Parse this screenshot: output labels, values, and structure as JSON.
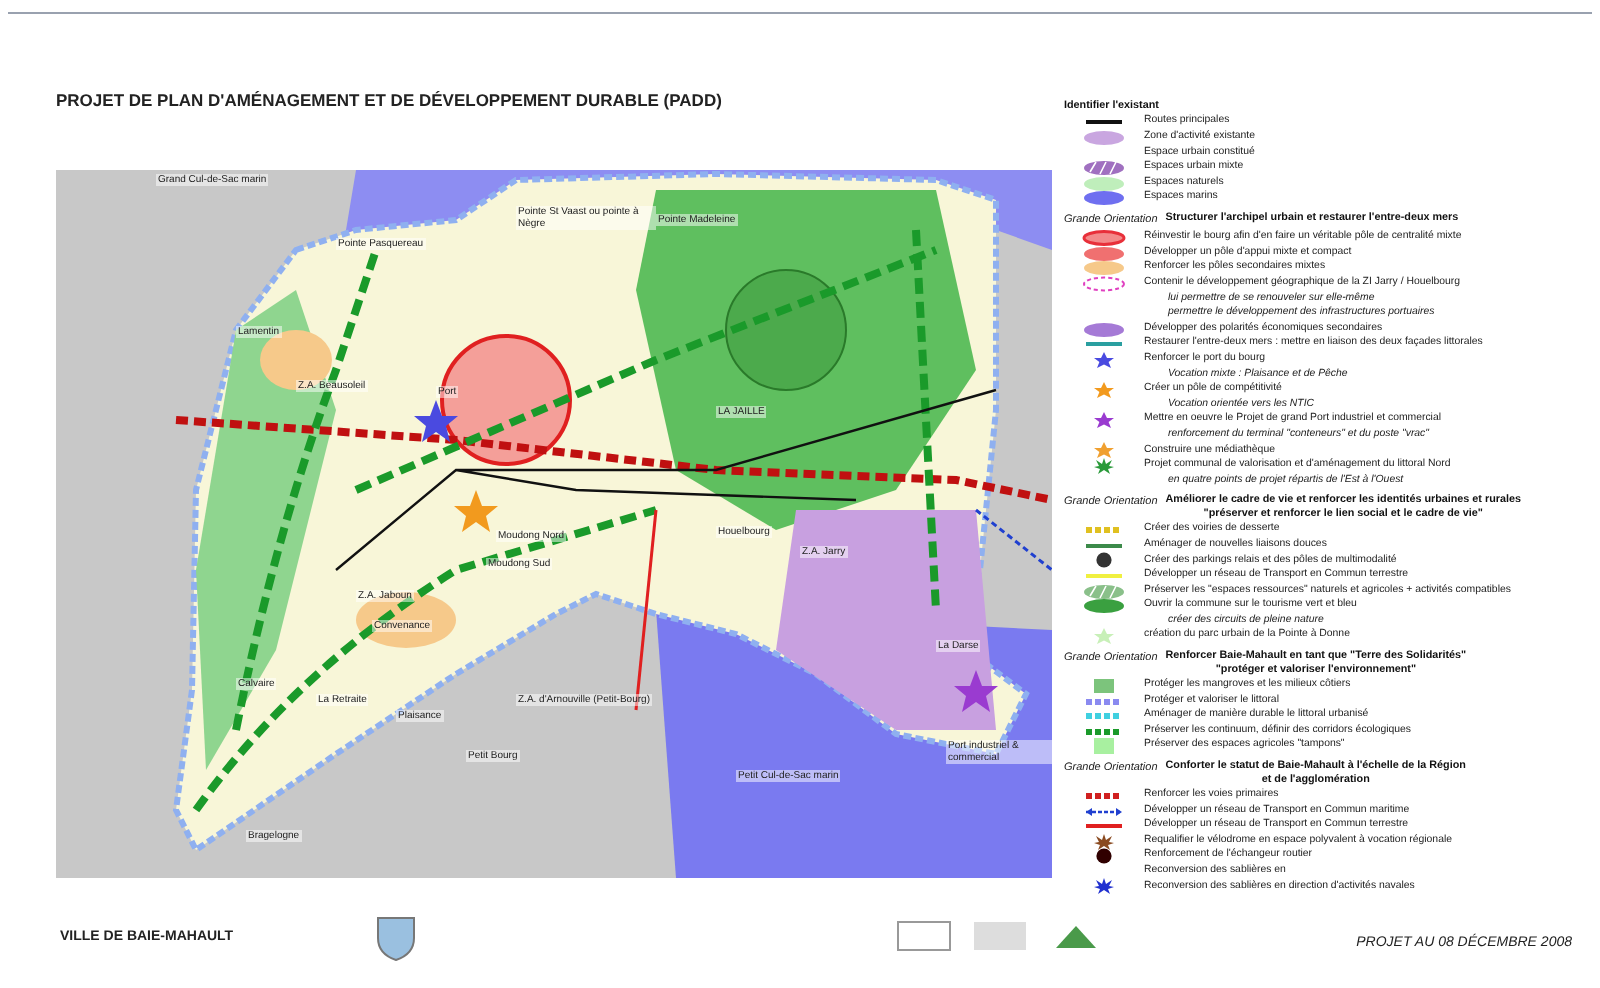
{
  "title": "PROJET DE PLAN D'AMÉNAGEMENT ET DE DÉVELOPPEMENT DURABLE (PADD)",
  "map_labels": [
    "Grand Cul-de-Sac marin",
    "Pointe St Vaast ou pointe à Nègre",
    "Pointe Madeleine",
    "Pointe Pasquereau",
    "Lamentin",
    "Z.A. Beausoleil",
    "LA JAILLE",
    "Moudong Nord",
    "Moudong Sud",
    "Houelbourg",
    "Z.A. Jarry",
    "Z.A. Jaboun",
    "Convenance",
    "Calvaire",
    "La Retraite",
    "Plaisance",
    "Bragelogne",
    "Petit Bourg",
    "Z.A. d'Arnouville (Petit-Bourg)",
    "Petit Cul-de-Sac marin",
    "La Darse",
    "Port",
    "Port industriel & commercial"
  ],
  "legend": [
    {
      "heading": "Identifier l'existant",
      "items": [
        {
          "kind": "line",
          "color": "#111111",
          "text": "Routes principales"
        },
        {
          "kind": "ellipse",
          "color": "#c9a6e0",
          "text": "Zone d'activité existante"
        },
        {
          "kind": "none",
          "text": "Espace urbain constitué"
        },
        {
          "kind": "hatch",
          "color": "#a070c0",
          "text": "Espaces urbain mixte"
        },
        {
          "kind": "ellipse",
          "color": "#bfeebb",
          "text": "Espaces naturels"
        },
        {
          "kind": "ellipse",
          "color": "#6f6ff0",
          "text": "Espaces marins"
        }
      ]
    },
    {
      "label": "Grande Orientation",
      "heading": "Structurer l'archipel urbain et restaurer l'entre-deux mers",
      "items": [
        {
          "kind": "ring",
          "color": "#e8303a",
          "text": "Réinvestir le bourg afin d'en faire un véritable pôle de centralité mixte"
        },
        {
          "kind": "ellipse",
          "color": "#f07070",
          "text": "Développer un pôle d'appui mixte et compact"
        },
        {
          "kind": "ellipse",
          "color": "#f6c98a",
          "text": "Renforcer les  pôles secondaires mixtes"
        },
        {
          "kind": "dashring",
          "color": "#e040c0",
          "text": "Contenir le développement géographique de la ZI Jarry / Houelbourg"
        },
        {
          "kind": "note",
          "text": "lui permettre de se renouveler sur elle-même"
        },
        {
          "kind": "note",
          "text": "permettre le développement des infrastructures portuaires"
        },
        {
          "kind": "ellipse",
          "color": "#a57ad6",
          "text": "Développer des polarités économiques secondaires"
        },
        {
          "kind": "line",
          "color": "#2a9fa0",
          "text": "Restaurer l'entre-deux mers : mettre en liaison des deux façades littorales"
        },
        {
          "kind": "star",
          "color": "#4a4ae0",
          "text": "Renforcer le port du bourg"
        },
        {
          "kind": "note",
          "text": "Vocation mixte : Plaisance et de Pêche"
        },
        {
          "kind": "star",
          "color": "#f29a1e",
          "text": "Créer un pôle de compétitivité"
        },
        {
          "kind": "note",
          "text": "Vocation orientée vers les NTIC"
        },
        {
          "kind": "star",
          "color": "#9a3bd0",
          "text": "Mettre en oeuvre le Projet de grand Port industriel et commercial"
        },
        {
          "kind": "note",
          "text": "renforcement du terminal \"conteneurs\" et du poste \"vrac\""
        },
        {
          "kind": "star",
          "color": "#f0a030",
          "text": "Construire une médiathèque"
        },
        {
          "kind": "burst",
          "color": "#2a9a3a",
          "text": "Projet communal de valorisation et d'aménagement du littoral Nord"
        },
        {
          "kind": "note",
          "text": "en quatre points de projet répartis de l'Est à l'Ouest"
        }
      ]
    },
    {
      "label": "Grande Orientation",
      "heading": "Améliorer le cadre de vie et renforcer les identités urbaines et rurales",
      "subheading": "\"préserver et renforcer le lien social et le cadre de vie\"",
      "items": [
        {
          "kind": "dash",
          "color": "#e0c020",
          "text": "Créer des voiries de desserte"
        },
        {
          "kind": "line",
          "color": "#3c8a4a",
          "text": "Aménager de nouvelles liaisons douces"
        },
        {
          "kind": "circle",
          "color": "#333333",
          "text": "Créer des parkings relais et des pôles de multimodalité"
        },
        {
          "kind": "line",
          "color": "#f0f040",
          "text": "Développer un réseau de Transport en Commun terrestre"
        },
        {
          "kind": "hatch",
          "color": "#8ac08a",
          "text": "Préserver les \"espaces ressources\" naturels et agricoles + activités compatibles"
        },
        {
          "kind": "ellipse",
          "color": "#3aa040",
          "text": "Ouvrir la commune sur le tourisme vert et bleu"
        },
        {
          "kind": "note",
          "text": "créer des circuits de pleine nature"
        },
        {
          "kind": "star",
          "color": "#c8f0b8",
          "text": "création du parc urbain de la Pointe à Donne"
        }
      ]
    },
    {
      "label": "Grande Orientation",
      "heading": "Renforcer Baie-Mahault en tant que \"Terre des Solidarités\"",
      "subheading": "\"protéger et valoriser l'environnement\"",
      "items": [
        {
          "kind": "rect",
          "color": "#7cc47c",
          "text": "Protéger les mangroves et les milieux côtiers"
        },
        {
          "kind": "dash",
          "color": "#8a8af0",
          "text": "Protéger et valoriser le littoral"
        },
        {
          "kind": "dash",
          "color": "#40d0e0",
          "text": "Aménager de manière durable le littoral urbanisé"
        },
        {
          "kind": "dash",
          "color": "#1a9a2a",
          "text": "Préserver les continuum, définir des corridors écologiques"
        },
        {
          "kind": "block",
          "color": "#a8f0a0",
          "text": "Préserver des espaces agricoles \"tampons\""
        }
      ]
    },
    {
      "label": "Grande Orientation",
      "heading": "Conforter le statut de Baie-Mahault à l'échelle de la Région",
      "subheading": "et de l'agglomération",
      "items": [
        {
          "kind": "dash",
          "color": "#d02020",
          "text": "Renforcer les voies primaires"
        },
        {
          "kind": "arrow",
          "color": "#2040d0",
          "text": "Développer un réseau de Transport en Commun maritime"
        },
        {
          "kind": "line",
          "color": "#e02020",
          "text": "Développer un réseau de Transport en Commun terrestre"
        },
        {
          "kind": "burst",
          "color": "#8a4a20",
          "text": "Requalifier le vélodrome en espace polyvalent à vocation régionale"
        },
        {
          "kind": "circle",
          "color": "#300000",
          "text": "Renforcement de l'échangeur routier"
        },
        {
          "kind": "none",
          "text": "Reconversion des sablières en"
        },
        {
          "kind": "burst",
          "color": "#2030d0",
          "text": "Reconversion des sablières en direction d'activités navales"
        }
      ]
    }
  ],
  "footer": {
    "city": "VILLE DE BAIE-MAHAULT",
    "date": "PROJET AU 08 DÉCEMBRE 2008"
  }
}
